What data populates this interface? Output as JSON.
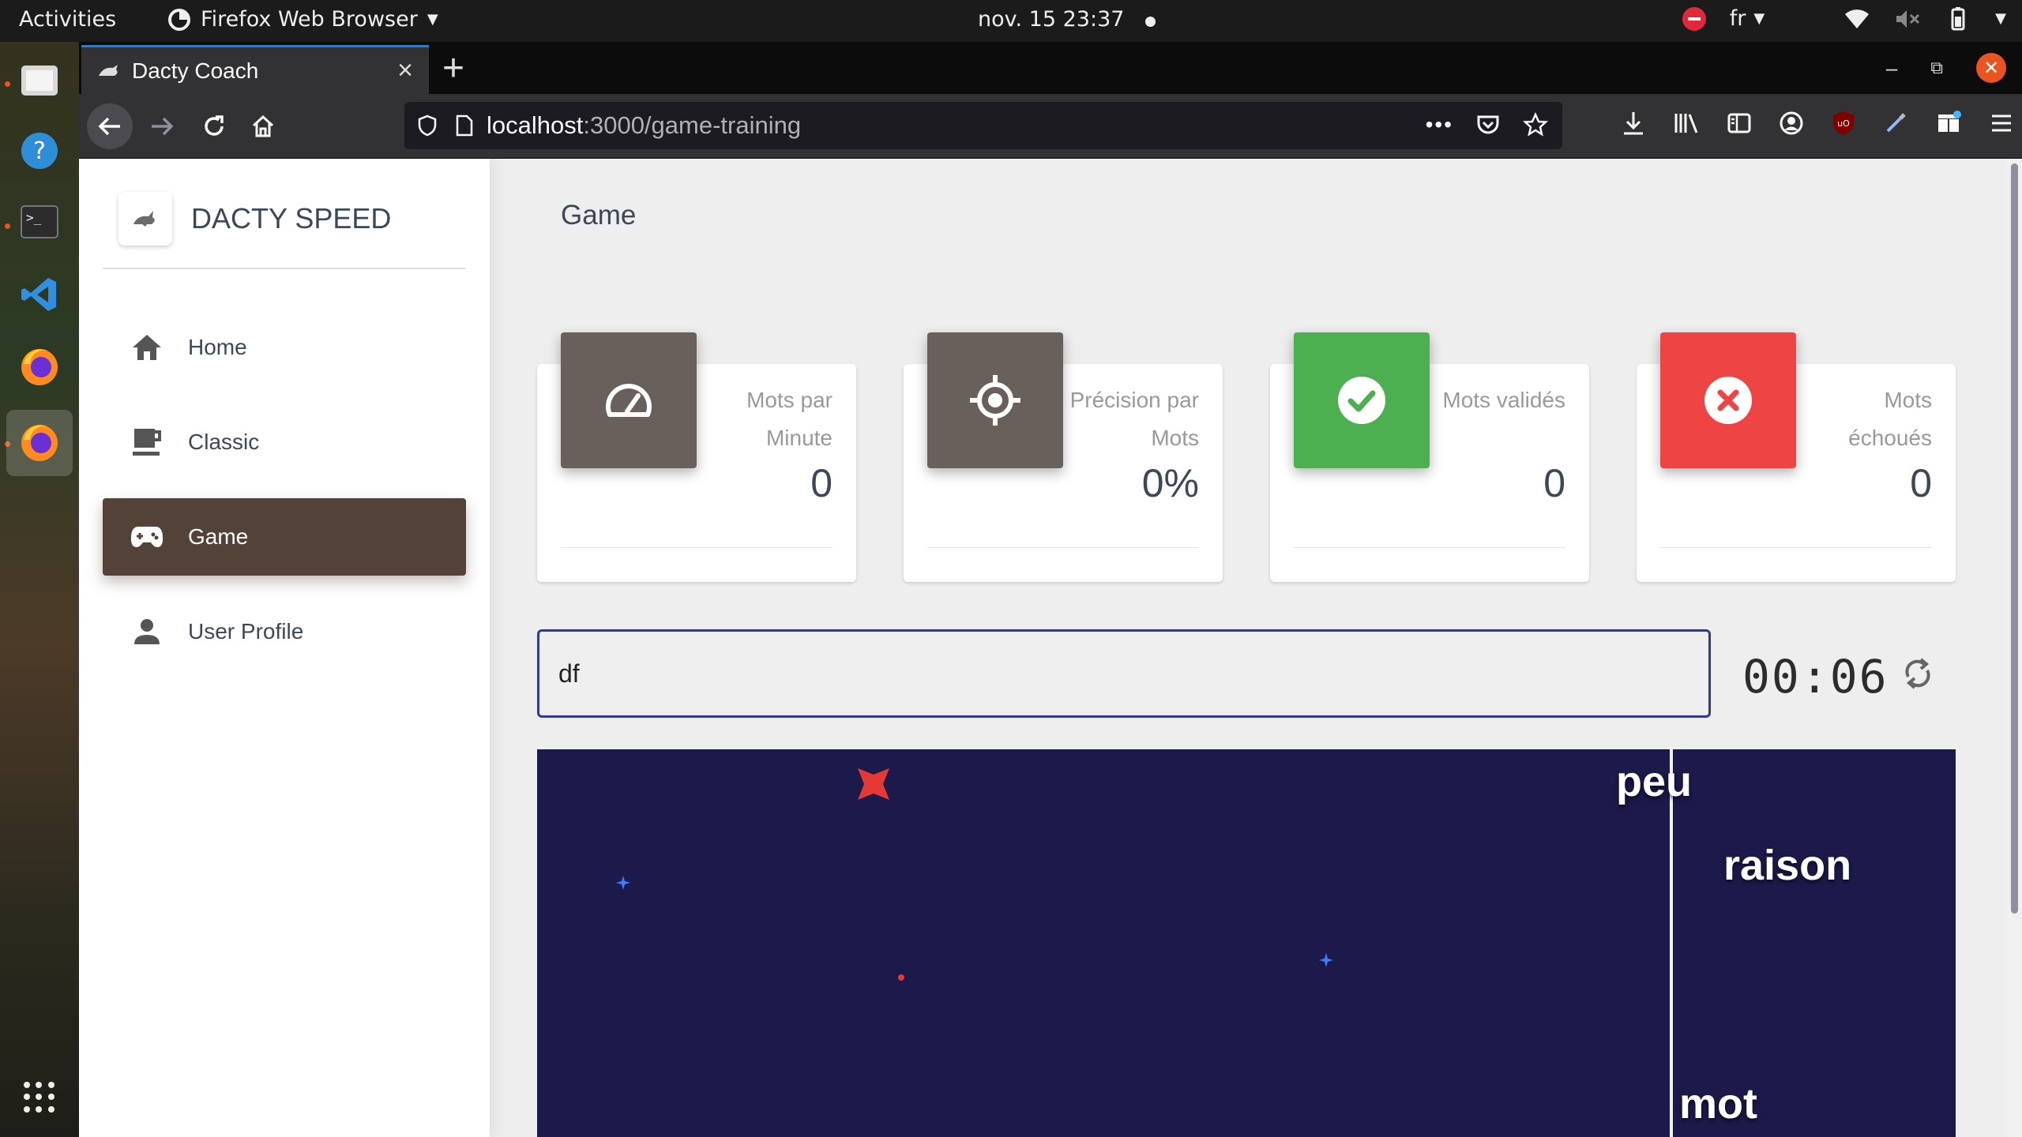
{
  "desktop": {
    "activities": "Activities",
    "app_menu": "Firefox Web Browser",
    "clock": "nov. 15  23:37",
    "keyboard_layout": "fr"
  },
  "browser": {
    "tab_title": "Dacty Coach",
    "url_host": "localhost",
    "url_path": ":3000/game-training"
  },
  "sidebar": {
    "brand": "DACTY SPEED",
    "items": [
      {
        "label": "Home",
        "icon": "home-icon",
        "active": false
      },
      {
        "label": "Classic",
        "icon": "coffee-icon",
        "active": false
      },
      {
        "label": "Game",
        "icon": "gamepad-icon",
        "active": true
      },
      {
        "label": "User Profile",
        "icon": "person-icon",
        "active": false
      }
    ]
  },
  "main": {
    "title": "Game",
    "stats": [
      {
        "label": "Mots par Minute",
        "value": "0",
        "icon": "speedometer-icon",
        "color": "#6a605b"
      },
      {
        "label": "Précision par Mots",
        "value": "0%",
        "icon": "crosshair-icon",
        "color": "#6a605b"
      },
      {
        "label": "Mots validés",
        "value": "0",
        "icon": "check-circle-icon",
        "color": "#4caf50"
      },
      {
        "label": "Mots échoués",
        "value": "0",
        "icon": "x-circle-icon",
        "color": "#ef4444"
      }
    ],
    "input_value": "df",
    "timer": "00:06",
    "game": {
      "background": "#1c1a4a",
      "words": [
        "peu",
        "raison",
        "mot"
      ]
    }
  },
  "colors": {
    "sidebar_active": "#524238",
    "input_border": "#2e3b8f"
  }
}
